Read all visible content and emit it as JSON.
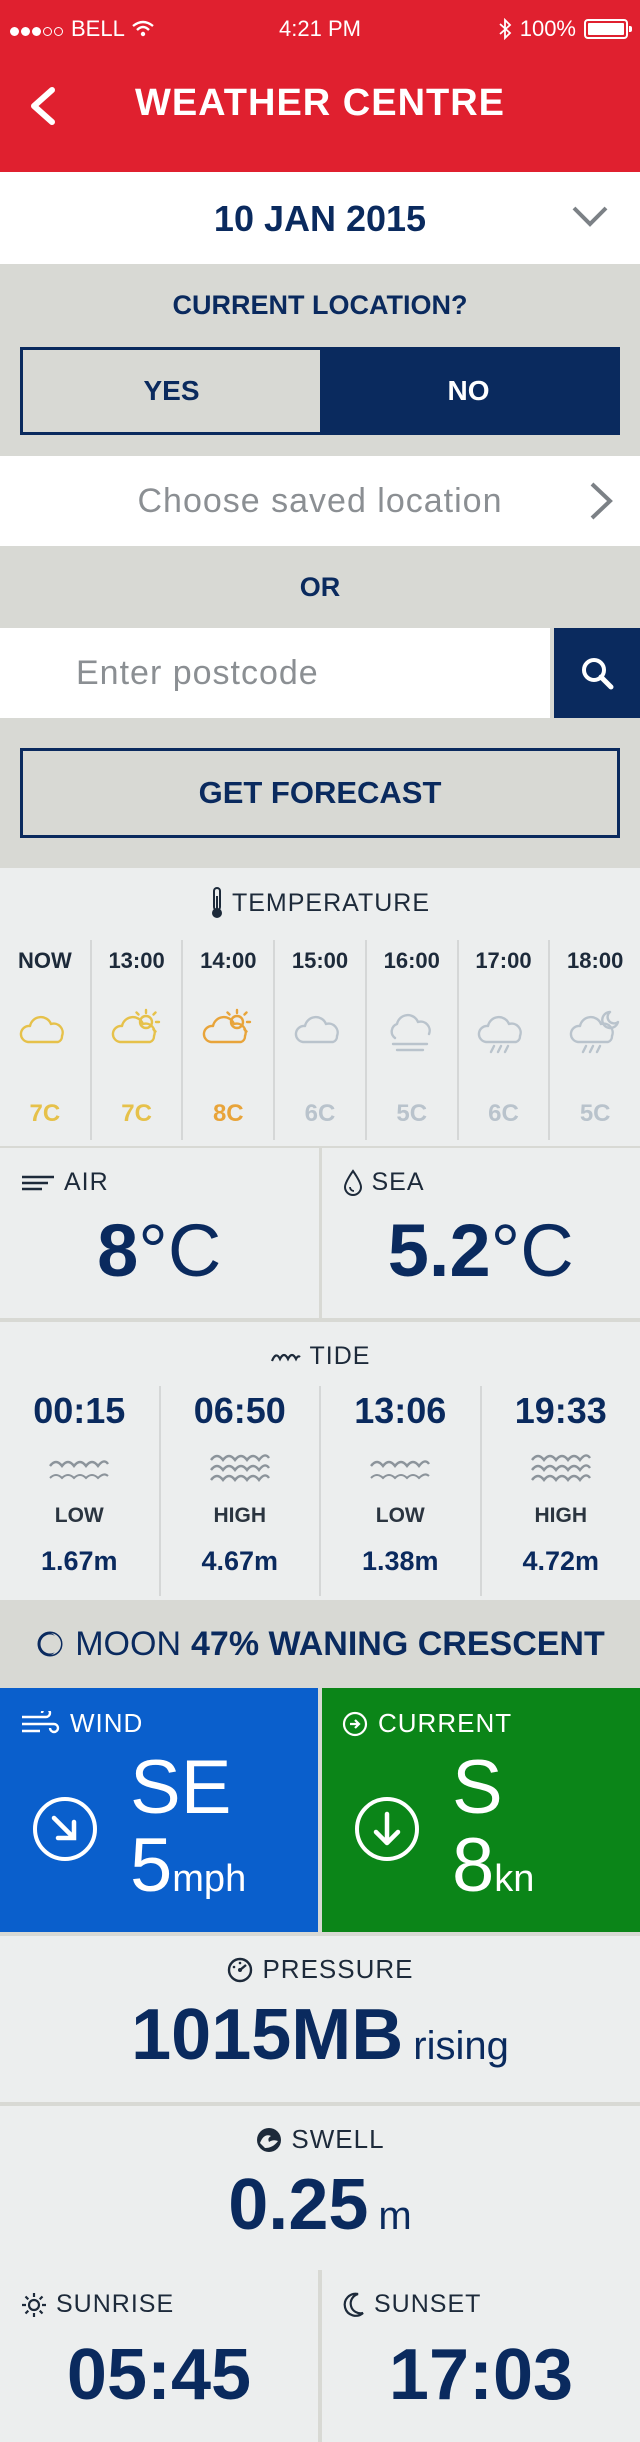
{
  "status_bar": {
    "carrier": "BELL",
    "time": "4:21 PM",
    "battery": "100%"
  },
  "nav": {
    "title": "WEATHER CENTRE"
  },
  "date_selector": {
    "date": "10 JAN 2015"
  },
  "location": {
    "question": "CURRENT LOCATION?",
    "yes_label": "YES",
    "no_label": "NO",
    "selected": "NO",
    "saved_placeholder": "Choose  saved location",
    "or_label": "OR",
    "postcode_placeholder": "Enter postcode",
    "postcode_value": ""
  },
  "get_forecast_label": "GET FORECAST",
  "temperature": {
    "label": "TEMPERATURE",
    "hours": [
      {
        "time": "NOW",
        "temp": "7C",
        "icon": "cloud-icon",
        "color": "#e6c14a"
      },
      {
        "time": "13:00",
        "temp": "7C",
        "icon": "sun-cloud-icon",
        "color": "#e6c14a"
      },
      {
        "time": "14:00",
        "temp": "8C",
        "icon": "sun-cloud-icon",
        "color": "#e8a43a"
      },
      {
        "time": "15:00",
        "temp": "6C",
        "icon": "cloud-icon",
        "color": "#b9c3cc"
      },
      {
        "time": "16:00",
        "temp": "5C",
        "icon": "fog-icon",
        "color": "#b9c3cc"
      },
      {
        "time": "17:00",
        "temp": "6C",
        "icon": "rain-cloud-icon",
        "color": "#b9c3cc"
      },
      {
        "time": "18:00",
        "temp": "5C",
        "icon": "rain-cloud-moon-icon",
        "color": "#b9c3cc"
      }
    ]
  },
  "air": {
    "label": "AIR",
    "value": "8",
    "unit": "°C"
  },
  "sea": {
    "label": "SEA",
    "value": "5.2",
    "unit": "°C"
  },
  "tide": {
    "label": "TIDE",
    "items": [
      {
        "time": "00:15",
        "kind": "LOW",
        "height": "1.67m"
      },
      {
        "time": "06:50",
        "kind": "HIGH",
        "height": "4.67m"
      },
      {
        "time": "13:06",
        "kind": "LOW",
        "height": "1.38m"
      },
      {
        "time": "19:33",
        "kind": "HIGH",
        "height": "4.72m"
      }
    ]
  },
  "moon": {
    "label": "MOON",
    "phase": "47% WANING CRESCENT"
  },
  "wind": {
    "label": "WIND",
    "direction": "SE",
    "speed": "5",
    "unit": "mph",
    "color": "#0a5fcc"
  },
  "current": {
    "label": "CURRENT",
    "direction": "S",
    "speed": "8",
    "unit": "kn",
    "color": "#0b8518"
  },
  "pressure": {
    "label": "PRESSURE",
    "value": "1015MB",
    "trend": "rising"
  },
  "swell": {
    "label": "SWELL",
    "value": "0.25",
    "unit": "m"
  },
  "sunrise": {
    "label": "SUNRISE",
    "value": "05:45"
  },
  "sunset": {
    "label": "SUNSET",
    "value": "17:03"
  },
  "colors": {
    "header_red": "#e0202f",
    "navy": "#0a2a5e",
    "band_grey": "#d8d9d4"
  }
}
